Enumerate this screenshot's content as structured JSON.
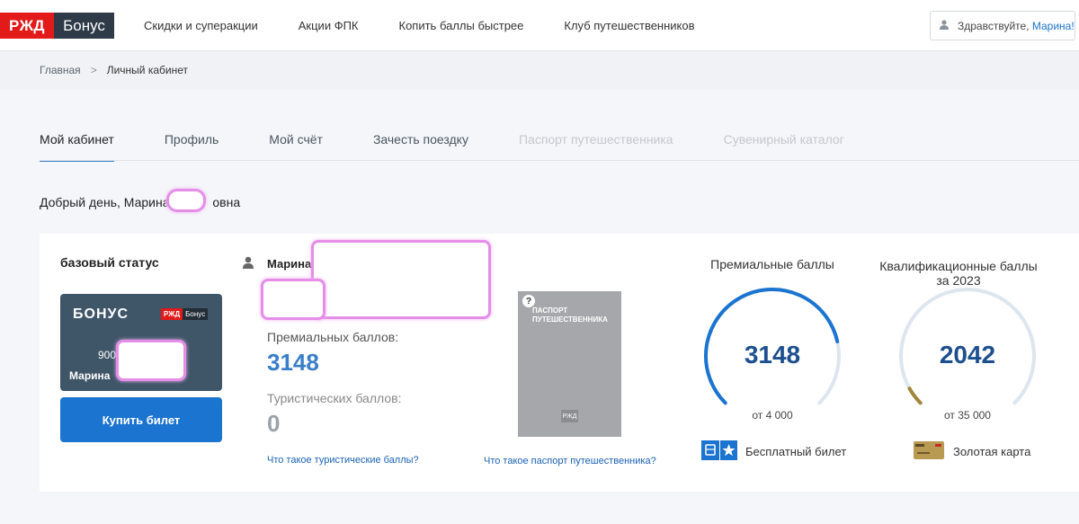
{
  "header": {
    "logo_left": "РЖД",
    "logo_right": "Бонус",
    "nav": [
      "Скидки и суперакции",
      "Акции ФПК",
      "Копить баллы быстрее",
      "Клуб путешественников"
    ],
    "greeting_prefix": "Здравствуйте,",
    "greeting_name": "Марина!"
  },
  "breadcrumb": {
    "home": "Главная",
    "separator": ">",
    "current": "Личный кабинет"
  },
  "tabs": [
    {
      "label": "Мой кабинет",
      "state": "active"
    },
    {
      "label": "Профиль",
      "state": "normal"
    },
    {
      "label": "Мой счёт",
      "state": "normal"
    },
    {
      "label": "Зачесть поездку",
      "state": "normal"
    },
    {
      "label": "Паспорт путешественника",
      "state": "disabled"
    },
    {
      "label": "Сувенирный каталог",
      "state": "disabled"
    }
  ],
  "welcome": {
    "prefix": "Добрый день, Марина ",
    "suffix": "овна"
  },
  "status": {
    "title": "базовый статус",
    "card_title": "БОНУС",
    "card_logo_left": "РЖД",
    "card_logo_right": "Бонус",
    "card_number_prefix": "900",
    "card_name": "Марина",
    "buy_button": "Купить билет"
  },
  "account": {
    "user_name": "Марина",
    "premium_label": "Премиальных баллов:",
    "premium_value": "3148",
    "tourist_label": "Туристических баллов:",
    "tourist_value": "0",
    "tourist_help": "Что такое туристические баллы?"
  },
  "passport": {
    "title_line1": "ПАСПОРТ",
    "title_line2": "ПУТЕШЕСТВЕННИКА",
    "question_mark": "?",
    "logo": "РЖД",
    "help": "Что такое паспорт путешественника?"
  },
  "gauges": [
    {
      "title": "Премиальные баллы",
      "value": "3148",
      "of": "от 4 000",
      "fraction": 0.787,
      "color": "#1b74cf",
      "reward": "Бесплатный билет",
      "reward_icon": "ticket-star-icon"
    },
    {
      "title": "Квалификационные баллы за 2023",
      "value": "2042",
      "of": "от 35 000",
      "fraction": 0.058,
      "color": "#a0863c",
      "reward": "Золотая карта",
      "reward_icon": "gold-card-icon"
    }
  ],
  "colors": {
    "accent": "#1b74cf",
    "brand_red": "#e21a1a",
    "brand_dark": "#2e3a48",
    "points": "#3a7fc8",
    "track": "#dde6ee"
  }
}
